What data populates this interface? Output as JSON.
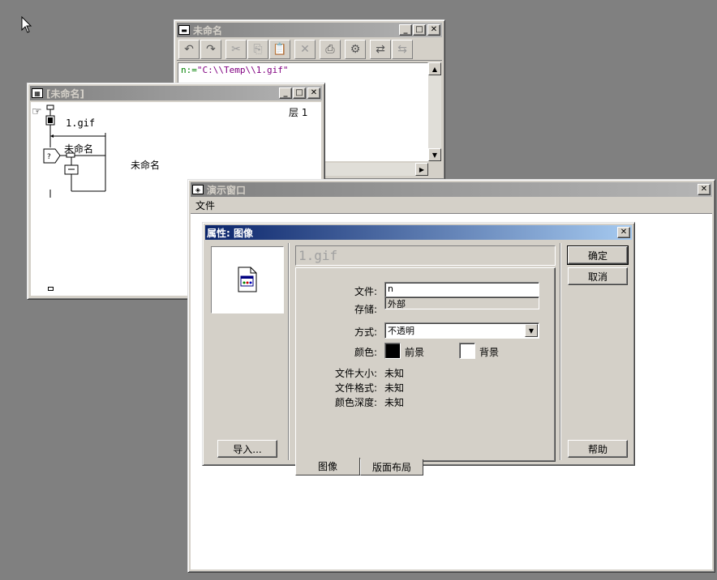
{
  "script_window": {
    "title": "未命名",
    "code_keyword": "n:=",
    "code_string": "\"C:\\\\Temp\\\\1.gif\""
  },
  "flow_window": {
    "title": "[未命名]",
    "layer_label": "层 1",
    "icon_label_gif": "1.gif",
    "interaction_label": "未命名",
    "map_label": "未命名"
  },
  "presentation_window": {
    "title": "演示窗口",
    "menu": [
      "文件"
    ]
  },
  "properties_dialog": {
    "title": "属性: 图像",
    "name_value": "1.gif",
    "buttons": {
      "ok": "确定",
      "cancel": "取消",
      "help": "帮助",
      "import": "导入..."
    },
    "fields": {
      "file_label": "文件:",
      "file_value": "n",
      "storage_label": "存储:",
      "storage_value": "外部",
      "mode_label": "方式:",
      "mode_value": "不透明",
      "color_label": "颜色:",
      "fg_label": "前景",
      "bg_label": "背景",
      "size_label": "文件大小:",
      "size_value": "未知",
      "format_label": "文件格式:",
      "format_value": "未知",
      "depth_label": "颜色深度:",
      "depth_value": "未知"
    },
    "colors": {
      "foreground": "#000000",
      "background": "#ffffff"
    },
    "tabs": [
      "图像",
      "版面布局"
    ]
  }
}
